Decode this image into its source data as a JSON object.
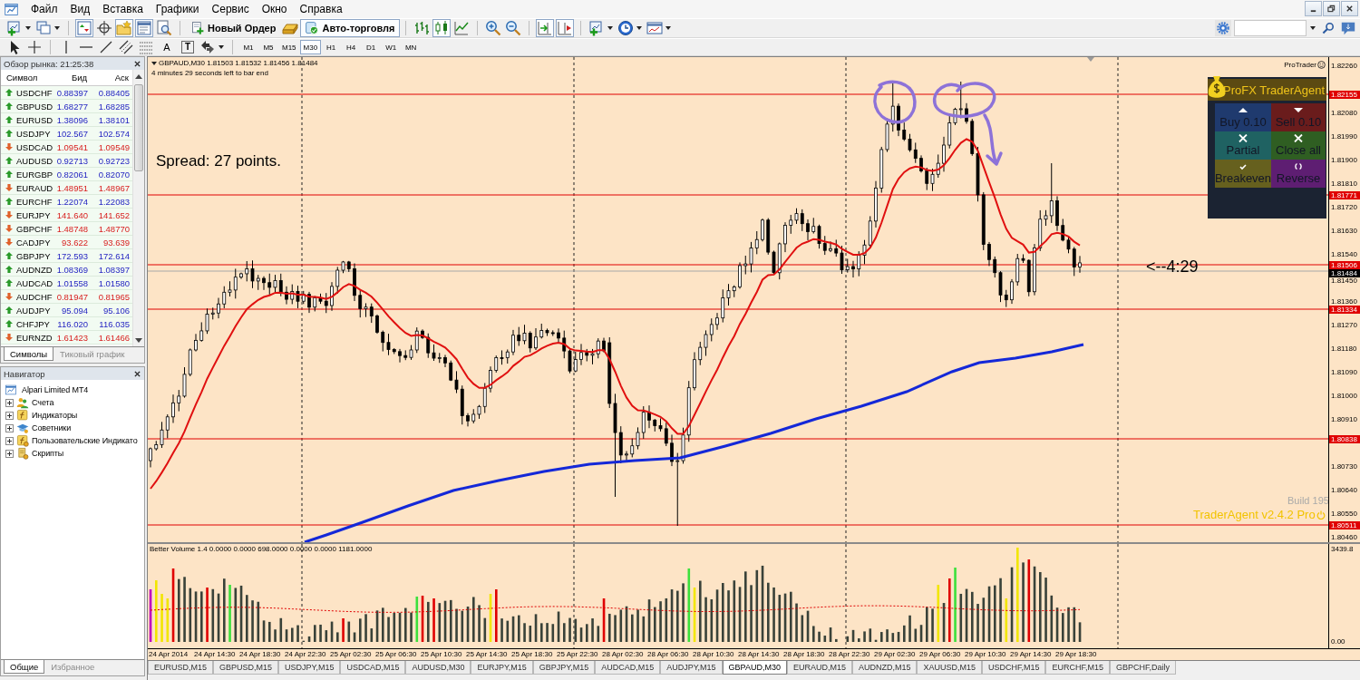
{
  "menu": [
    "Файл",
    "Вид",
    "Вставка",
    "Графики",
    "Сервис",
    "Окно",
    "Справка"
  ],
  "toolbar": [
    {
      "kind": "new-chart",
      "on": false
    },
    {
      "kind": "profiles",
      "on": false
    },
    {
      "kind": "market-watch",
      "on": true
    },
    {
      "kind": "data-window",
      "on": false
    },
    {
      "kind": "navigator",
      "on": true
    },
    {
      "kind": "terminal",
      "on": true
    },
    {
      "kind": "tester",
      "on": false
    },
    {
      "kind": "new-order",
      "label": "Новый Ордер",
      "on": false
    },
    {
      "kind": "gold",
      "on": false
    },
    {
      "kind": "auto-trading",
      "label": "Авто-торговля",
      "on": true
    },
    {
      "kind": "bar-chart",
      "on": false
    },
    {
      "kind": "candles",
      "on": true
    },
    {
      "kind": "line-chart",
      "on": false
    },
    {
      "kind": "zoom-in",
      "on": false
    },
    {
      "kind": "zoom-out",
      "on": false
    },
    {
      "kind": "auto-scroll",
      "on": true
    },
    {
      "kind": "chart-shift",
      "on": true
    },
    {
      "kind": "indicators",
      "on": false
    },
    {
      "kind": "periods",
      "on": false
    },
    {
      "kind": "templates",
      "on": false
    }
  ],
  "drawing_tools": [
    {
      "kind": "cursor"
    },
    {
      "kind": "crosshair"
    },
    {
      "kind": "vertical-line"
    },
    {
      "kind": "horizontal-line"
    },
    {
      "kind": "trend-line"
    },
    {
      "kind": "channel"
    },
    {
      "kind": "fibonacci"
    },
    {
      "kind": "text",
      "glyph": "A"
    },
    {
      "kind": "label",
      "glyph": "T"
    },
    {
      "kind": "arrows"
    }
  ],
  "periods": [
    {
      "label": "M1",
      "selected": false
    },
    {
      "label": "M5",
      "selected": false
    },
    {
      "label": "M15",
      "selected": false
    },
    {
      "label": "M30",
      "selected": true
    },
    {
      "label": "H1",
      "selected": false
    },
    {
      "label": "H4",
      "selected": false
    },
    {
      "label": "D1",
      "selected": false
    },
    {
      "label": "W1",
      "selected": false
    },
    {
      "label": "MN",
      "selected": false
    }
  ],
  "market_watch": {
    "title": "Обзор рынка: 21:25:38",
    "columns": [
      "Символ",
      "Бид",
      "Аск"
    ],
    "rows": [
      {
        "symbol": "USDCHF",
        "bid": "0.88397",
        "ask": "0.88405",
        "rising": true
      },
      {
        "symbol": "GBPUSD",
        "bid": "1.68277",
        "ask": "1.68285",
        "rising": true
      },
      {
        "symbol": "EURUSD",
        "bid": "1.38096",
        "ask": "1.38101",
        "rising": true
      },
      {
        "symbol": "USDJPY",
        "bid": "102.567",
        "ask": "102.574",
        "rising": true
      },
      {
        "symbol": "USDCAD",
        "bid": "1.09541",
        "ask": "1.09549",
        "rising": false
      },
      {
        "symbol": "AUDUSD",
        "bid": "0.92713",
        "ask": "0.92723",
        "rising": true
      },
      {
        "symbol": "EURGBP",
        "bid": "0.82061",
        "ask": "0.82070",
        "rising": true
      },
      {
        "symbol": "EURAUD",
        "bid": "1.48951",
        "ask": "1.48967",
        "rising": false
      },
      {
        "symbol": "EURCHF",
        "bid": "1.22074",
        "ask": "1.22083",
        "rising": true
      },
      {
        "symbol": "EURJPY",
        "bid": "141.640",
        "ask": "141.652",
        "rising": false
      },
      {
        "symbol": "GBPCHF",
        "bid": "1.48748",
        "ask": "1.48770",
        "rising": false
      },
      {
        "symbol": "CADJPY",
        "bid": "93.622",
        "ask": "93.639",
        "rising": false
      },
      {
        "symbol": "GBPJPY",
        "bid": "172.593",
        "ask": "172.614",
        "rising": true
      },
      {
        "symbol": "AUDNZD",
        "bid": "1.08369",
        "ask": "1.08397",
        "rising": true
      },
      {
        "symbol": "AUDCAD",
        "bid": "1.01558",
        "ask": "1.01580",
        "rising": true
      },
      {
        "symbol": "AUDCHF",
        "bid": "0.81947",
        "ask": "0.81965",
        "rising": false
      },
      {
        "symbol": "AUDJPY",
        "bid": "95.094",
        "ask": "95.106",
        "rising": true
      },
      {
        "symbol": "CHFJPY",
        "bid": "116.020",
        "ask": "116.035",
        "rising": true
      },
      {
        "symbol": "EURNZD",
        "bid": "1.61423",
        "ask": "1.61466",
        "rising": false
      }
    ],
    "tabs": [
      {
        "label": "Символы",
        "selected": true
      },
      {
        "label": "Тиковый график",
        "selected": false
      }
    ]
  },
  "navigator": {
    "title": "Навигатор",
    "tree": [
      {
        "label": "Alpari Limited MT4",
        "kind": "server",
        "children": [
          {
            "label": "Счета",
            "kind": "accounts",
            "expanded": false
          },
          {
            "label": "Индикаторы",
            "kind": "indicators",
            "expanded": false
          },
          {
            "label": "Советники",
            "kind": "experts",
            "expanded": false
          },
          {
            "label": "Пользовательские Индикато",
            "kind": "custom-indicators",
            "expanded": false
          },
          {
            "label": "Скрипты",
            "kind": "scripts",
            "expanded": false
          }
        ]
      }
    ],
    "tabs": [
      {
        "label": "Общие",
        "selected": true
      },
      {
        "label": "Избранное",
        "selected": false
      }
    ]
  },
  "chart": {
    "symbol_line": "GBPAUD,M30 1.81503 1.81532 1.81456 1.81484",
    "timer": "4 minutes 29 seconds left to bar end",
    "spread": "Spread: 27 points.",
    "countdown": "<--4:29",
    "brand": "ProTrader",
    "price_ticks": [
      "1.82260",
      "1.82080",
      "1.81990",
      "1.81900",
      "1.81810",
      "1.81720",
      "1.81630",
      "1.81540",
      "1.81450",
      "1.81360",
      "1.81270",
      "1.81180",
      "1.81090",
      "1.81000",
      "1.80910",
      "1.80730",
      "1.80640",
      "1.80550",
      "1.80460"
    ],
    "price_levels": [
      "1.82155",
      "1.81771",
      "1.81506",
      "1.81334",
      "1.80838",
      "1.80511"
    ],
    "current_price": "1.81484",
    "trader_agent": {
      "title": "ProFX TraderAgent",
      "buttons": [
        {
          "label": "Buy 0.10",
          "kind": "buy"
        },
        {
          "label": "Sell 0.10",
          "kind": "sell"
        },
        {
          "label": "Partial",
          "kind": "partial"
        },
        {
          "label": "Close all",
          "kind": "close-all"
        },
        {
          "label": "Breakeven",
          "kind": "breakeven"
        },
        {
          "label": "Reverse",
          "kind": "reverse"
        }
      ],
      "build": "Build 195",
      "version": "TraderAgent v2.4.2 Pro"
    },
    "indicator": {
      "label": "Better Volume 1.4 0.0000 0.0000 698.0000 0.0000 0.0000 1181.0000",
      "scale_max": "3439.8",
      "scale_min": "0.00"
    },
    "time_ticks": [
      "24 Apr 2014",
      "24 Apr 14:30",
      "24 Apr 18:30",
      "24 Apr 22:30",
      "25 Apr 02:30",
      "25 Apr 06:30",
      "25 Apr 10:30",
      "25 Apr 14:30",
      "25 Apr 18:30",
      "25 Apr 22:30",
      "28 Apr 02:30",
      "28 Apr 06:30",
      "28 Apr 10:30",
      "28 Apr 14:30",
      "28 Apr 18:30",
      "28 Apr 22:30",
      "29 Apr 02:30",
      "29 Apr 06:30",
      "29 Apr 10:30",
      "29 Apr 14:30",
      "29 Apr 18:30"
    ]
  },
  "chart_tabs": [
    {
      "label": "EURUSD,M15",
      "selected": false
    },
    {
      "label": "GBPUSD,M15",
      "selected": false
    },
    {
      "label": "USDJPY,M15",
      "selected": false
    },
    {
      "label": "USDCAD,M15",
      "selected": false
    },
    {
      "label": "AUDUSD,M30",
      "selected": false
    },
    {
      "label": "EURJPY,M15",
      "selected": false
    },
    {
      "label": "GBPJPY,M15",
      "selected": false
    },
    {
      "label": "AUDCAD,M15",
      "selected": false
    },
    {
      "label": "AUDJPY,M15",
      "selected": false
    },
    {
      "label": "GBPAUD,M30",
      "selected": true
    },
    {
      "label": "EURAUD,M15",
      "selected": false
    },
    {
      "label": "AUDNZD,M15",
      "selected": false
    },
    {
      "label": "XAUUSD,M15",
      "selected": false
    },
    {
      "label": "USDCHF,M15",
      "selected": false
    },
    {
      "label": "EURCHF,M15",
      "selected": false
    },
    {
      "label": "GBPCHF,Daily",
      "selected": false
    }
  ]
}
